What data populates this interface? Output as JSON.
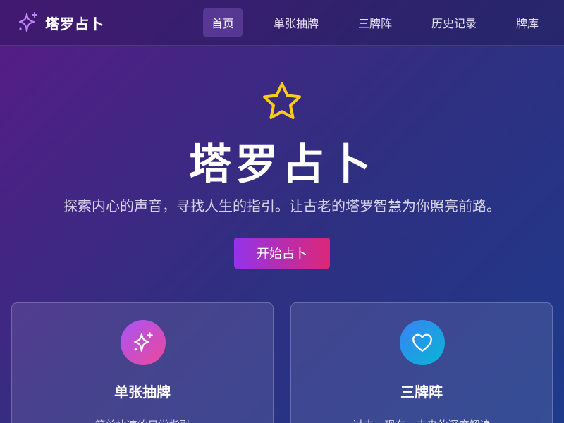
{
  "brand": {
    "name": "塔罗占卜",
    "icon": "sparkles-icon"
  },
  "nav": {
    "items": [
      {
        "label": "首页",
        "active": true
      },
      {
        "label": "单张抽牌",
        "active": false
      },
      {
        "label": "三牌阵",
        "active": false
      },
      {
        "label": "历史记录",
        "active": false
      },
      {
        "label": "牌库",
        "active": false
      }
    ]
  },
  "hero": {
    "icon": "star-icon",
    "title": "塔罗占卜",
    "subtitle": "探索内心的声音，寻找人生的指引。让古老的塔罗智慧为你照亮前路。",
    "cta_label": "开始占卜"
  },
  "cards": [
    {
      "icon": "sparkles-icon",
      "title": "单张抽牌",
      "description": "简单快速的日常指引"
    },
    {
      "icon": "heart-icon",
      "title": "三牌阵",
      "description": "过去、现在、未来的深度解读"
    }
  ],
  "colors": {
    "accent_star": "#facc15",
    "brand_icon": "#c084fc",
    "cta_gradient": [
      "#9333ea",
      "#db2777"
    ],
    "card1_gradient": [
      "#a855f7",
      "#ec4899"
    ],
    "card2_gradient": [
      "#3b82f6",
      "#06b6d4"
    ]
  }
}
